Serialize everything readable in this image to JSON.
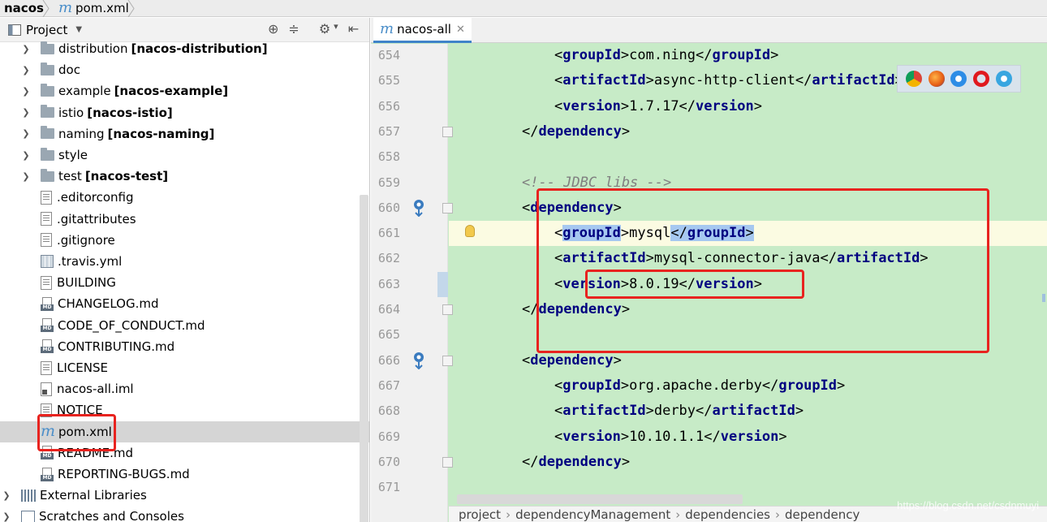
{
  "breadcrumb": {
    "root": "nacos",
    "file": "pom.xml"
  },
  "project_panel": {
    "title": "Project",
    "items": [
      {
        "type": "folder",
        "name": "distribution",
        "module": "[nacos-distribution]",
        "expandable": true
      },
      {
        "type": "folder",
        "name": "doc",
        "module": "",
        "expandable": true
      },
      {
        "type": "folder",
        "name": "example",
        "module": "[nacos-example]",
        "expandable": true
      },
      {
        "type": "folder",
        "name": "istio",
        "module": "[nacos-istio]",
        "expandable": true
      },
      {
        "type": "folder",
        "name": "naming",
        "module": "[nacos-naming]",
        "expandable": true
      },
      {
        "type": "folder",
        "name": "style",
        "module": "",
        "expandable": true
      },
      {
        "type": "folder",
        "name": "test",
        "module": "[nacos-test]",
        "expandable": true
      },
      {
        "type": "file",
        "name": ".editorconfig"
      },
      {
        "type": "file",
        "name": ".gitattributes"
      },
      {
        "type": "file",
        "name": ".gitignore"
      },
      {
        "type": "yml",
        "name": ".travis.yml"
      },
      {
        "type": "file",
        "name": "BUILDING"
      },
      {
        "type": "md",
        "name": "CHANGELOG.md"
      },
      {
        "type": "md",
        "name": "CODE_OF_CONDUCT.md"
      },
      {
        "type": "md",
        "name": "CONTRIBUTING.md"
      },
      {
        "type": "file",
        "name": "LICENSE"
      },
      {
        "type": "iml",
        "name": "nacos-all.iml"
      },
      {
        "type": "file",
        "name": "NOTICE"
      },
      {
        "type": "maven",
        "name": "pom.xml",
        "selected": true
      },
      {
        "type": "md",
        "name": "README.md"
      },
      {
        "type": "md",
        "name": "REPORTING-BUGS.md"
      }
    ],
    "external_libraries": "External Libraries",
    "scratches": "Scratches and Consoles"
  },
  "editor": {
    "tab_label": "nacos-all",
    "current_line": 661,
    "lines": [
      {
        "num": "654",
        "indent": 2,
        "parts": [
          {
            "k": "p",
            "t": "<"
          },
          {
            "k": "t",
            "t": "groupId"
          },
          {
            "k": "p",
            "t": ">com.ning</"
          },
          {
            "k": "t",
            "t": "groupId"
          },
          {
            "k": "p",
            "t": ">"
          }
        ]
      },
      {
        "num": "655",
        "indent": 2,
        "parts": [
          {
            "k": "p",
            "t": "<"
          },
          {
            "k": "t",
            "t": "artifactId"
          },
          {
            "k": "p",
            "t": ">async-http-client</"
          },
          {
            "k": "t",
            "t": "artifactId"
          },
          {
            "k": "p",
            "t": ">"
          }
        ]
      },
      {
        "num": "656",
        "indent": 2,
        "parts": [
          {
            "k": "p",
            "t": "<"
          },
          {
            "k": "t",
            "t": "version"
          },
          {
            "k": "p",
            "t": ">1.7.17</"
          },
          {
            "k": "t",
            "t": "version"
          },
          {
            "k": "p",
            "t": ">"
          }
        ]
      },
      {
        "num": "657",
        "indent": 1,
        "fold": true,
        "parts": [
          {
            "k": "p",
            "t": "</"
          },
          {
            "k": "t",
            "t": "dependency"
          },
          {
            "k": "p",
            "t": ">"
          }
        ]
      },
      {
        "num": "658",
        "indent": 0,
        "parts": []
      },
      {
        "num": "659",
        "indent": 1,
        "parts": [
          {
            "k": "c",
            "t": "<!-- JDBC libs -->"
          }
        ]
      },
      {
        "num": "660",
        "indent": 1,
        "fold": true,
        "gutter_icon": true,
        "parts": [
          {
            "k": "p",
            "t": "<"
          },
          {
            "k": "t",
            "t": "dependency"
          },
          {
            "k": "p",
            "t": ">"
          }
        ]
      },
      {
        "num": "661",
        "indent": 2,
        "bulb": true,
        "parts": [
          {
            "k": "p",
            "t": "<"
          },
          {
            "k": "th",
            "t": "groupId"
          },
          {
            "k": "p",
            "t": ">mysql"
          },
          {
            "k": "ph",
            "t": "</"
          },
          {
            "k": "th",
            "t": "groupId"
          },
          {
            "k": "ph",
            "t": ">"
          }
        ]
      },
      {
        "num": "662",
        "indent": 2,
        "parts": [
          {
            "k": "p",
            "t": "<"
          },
          {
            "k": "t",
            "t": "artifactId"
          },
          {
            "k": "p",
            "t": ">mysql-connector-java</"
          },
          {
            "k": "t",
            "t": "artifactId"
          },
          {
            "k": "p",
            "t": ">"
          }
        ]
      },
      {
        "num": "663",
        "indent": 2,
        "caret": true,
        "parts": [
          {
            "k": "p",
            "t": "<"
          },
          {
            "k": "t",
            "t": "version"
          },
          {
            "k": "p",
            "t": ">8.0.19</"
          },
          {
            "k": "t",
            "t": "version"
          },
          {
            "k": "p",
            "t": ">"
          }
        ]
      },
      {
        "num": "664",
        "indent": 1,
        "fold": true,
        "parts": [
          {
            "k": "p",
            "t": "</"
          },
          {
            "k": "t",
            "t": "dependency"
          },
          {
            "k": "p",
            "t": ">"
          }
        ]
      },
      {
        "num": "665",
        "indent": 0,
        "parts": []
      },
      {
        "num": "666",
        "indent": 1,
        "fold": true,
        "gutter_icon": true,
        "parts": [
          {
            "k": "p",
            "t": "<"
          },
          {
            "k": "t",
            "t": "dependency"
          },
          {
            "k": "p",
            "t": ">"
          }
        ]
      },
      {
        "num": "667",
        "indent": 2,
        "parts": [
          {
            "k": "p",
            "t": "<"
          },
          {
            "k": "t",
            "t": "groupId"
          },
          {
            "k": "p",
            "t": ">org.apache.derby</"
          },
          {
            "k": "t",
            "t": "groupId"
          },
          {
            "k": "p",
            "t": ">"
          }
        ]
      },
      {
        "num": "668",
        "indent": 2,
        "parts": [
          {
            "k": "p",
            "t": "<"
          },
          {
            "k": "t",
            "t": "artifactId"
          },
          {
            "k": "p",
            "t": ">derby</"
          },
          {
            "k": "t",
            "t": "artifactId"
          },
          {
            "k": "p",
            "t": ">"
          }
        ]
      },
      {
        "num": "669",
        "indent": 2,
        "parts": [
          {
            "k": "p",
            "t": "<"
          },
          {
            "k": "t",
            "t": "version"
          },
          {
            "k": "p",
            "t": ">10.10.1.1</"
          },
          {
            "k": "t",
            "t": "version"
          },
          {
            "k": "p",
            "t": ">"
          }
        ]
      },
      {
        "num": "670",
        "indent": 1,
        "fold": true,
        "parts": [
          {
            "k": "p",
            "t": "</"
          },
          {
            "k": "t",
            "t": "dependency"
          },
          {
            "k": "p",
            "t": ">"
          }
        ]
      },
      {
        "num": "671",
        "indent": 0,
        "parts": []
      }
    ],
    "breadcrumbs": [
      "project",
      "dependencyManagement",
      "dependencies",
      "dependency"
    ]
  },
  "browser_icons": [
    "chrome-icon",
    "firefox-icon",
    "safari-icon",
    "opera-icon",
    "ie-icon"
  ],
  "watermark": "https://blog.csdn.net/csdnmuyi",
  "colors": {
    "editor_bg": "#c7ebc7",
    "tag": "#000080",
    "annotation": "#e8231f",
    "tag_highlight": "#a6c8f0"
  }
}
